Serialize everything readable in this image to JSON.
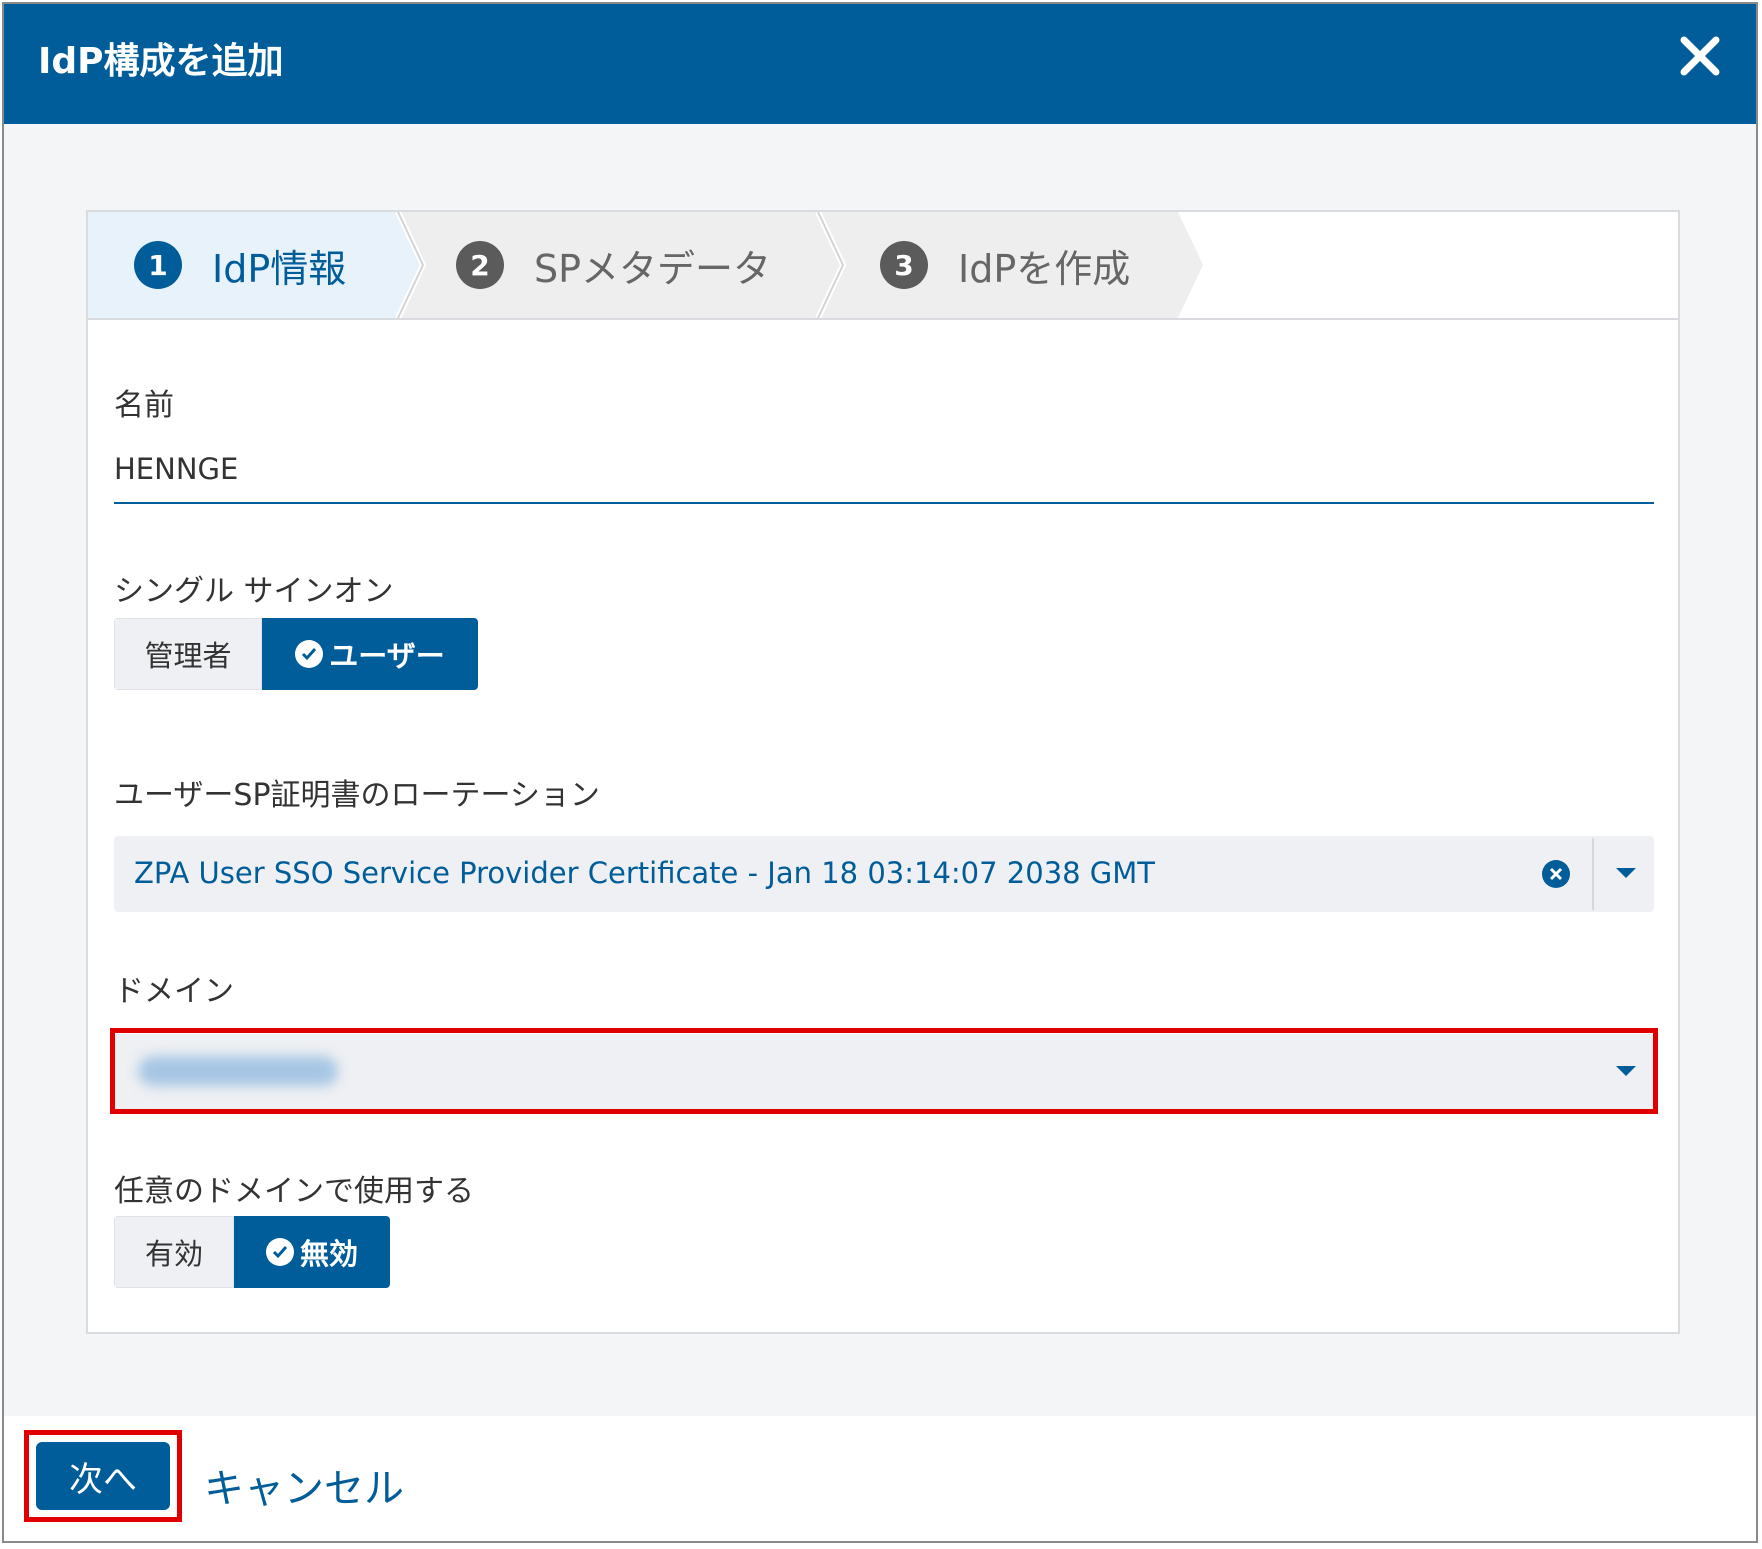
{
  "dialog": {
    "title": "IdP構成を追加",
    "close_icon": "close-icon"
  },
  "steps": [
    {
      "number": "1",
      "label": "IdP情報",
      "active": true
    },
    {
      "number": "2",
      "label": "SPメタデータ",
      "active": false
    },
    {
      "number": "3",
      "label": "IdPを作成",
      "active": false
    }
  ],
  "form": {
    "name": {
      "label": "名前",
      "value": "HENNGE"
    },
    "sso": {
      "label": "シングル サインオン",
      "options": [
        "管理者",
        "ユーザー"
      ],
      "selected": "ユーザー"
    },
    "cert_rotation": {
      "label": "ユーザーSP証明書のローテーション",
      "value": "ZPA User SSO Service Provider Certificate - Jan 18 03:14:07 2038 GMT"
    },
    "domain": {
      "label": "ドメイン",
      "value_obscured": true
    },
    "any_domain": {
      "label": "任意のドメインで使用する",
      "options": [
        "有効",
        "無効"
      ],
      "selected": "無効"
    }
  },
  "footer": {
    "next_label": "次へ",
    "cancel_label": "キャンセル"
  },
  "colors": {
    "brand": "#005d99",
    "highlight": "#e00000",
    "step_active_bg": "#e8f2fa",
    "step_inactive_bg": "#eeeeee"
  }
}
